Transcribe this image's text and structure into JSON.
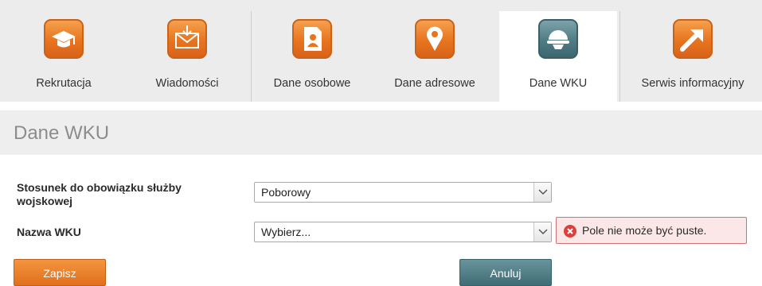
{
  "nav": {
    "items": [
      {
        "label": "Rekrutacja",
        "icon": "graduation-cap-icon"
      },
      {
        "label": "Wiadomości",
        "icon": "envelope-icon"
      },
      {
        "label": "Dane osobowe",
        "icon": "person-document-icon"
      },
      {
        "label": "Dane adresowe",
        "icon": "map-pin-icon"
      },
      {
        "label": "Dane WKU",
        "icon": "helmet-icon",
        "active": true
      },
      {
        "label": "Serwis informacyjny",
        "icon": "arrow-icon"
      }
    ]
  },
  "section": {
    "title": "Dane WKU"
  },
  "form": {
    "service_label": "Stosunek do obowiązku służby wojskowej",
    "service_value": "Poborowy",
    "wku_label": "Nazwa WKU",
    "wku_value": "Wybierz...",
    "error_text": "Pole nie może być puste."
  },
  "buttons": {
    "save": "Zapisz",
    "cancel": "Anuluj"
  },
  "colors": {
    "accent_orange": "#e8741e",
    "accent_teal": "#4f7b83",
    "error_red": "#d9423b"
  }
}
